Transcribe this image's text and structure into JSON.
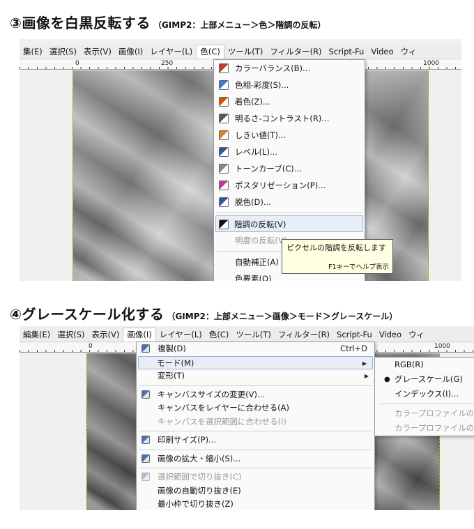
{
  "heading1": {
    "number": "③",
    "title": "画像を白黒反転する",
    "note": "（GIMP2：上部メニュー＞色＞階調の反転）"
  },
  "heading2": {
    "number": "④",
    "title": "グレースケール化する",
    "note": "（GIMP2：上部メニュー＞画像＞モード＞グレースケール）"
  },
  "shot1": {
    "menubar": [
      "集(E)",
      "選択(S)",
      "表示(V)",
      "画像(I)",
      "レイヤー(L)",
      "色(C)",
      "ツール(T)",
      "フィルター(R)",
      "Script-Fu",
      "Video",
      "ウィ"
    ],
    "ruler": [
      "0",
      "250",
      "1000"
    ],
    "colors_menu": {
      "items": [
        {
          "label": "カラーバランス(B)...",
          "icon": "color-balance-icon",
          "color": "#c0392b"
        },
        {
          "label": "色相-彩度(S)...",
          "icon": "hue-saturation-icon",
          "color": "#3b7bd4"
        },
        {
          "label": "着色(Z)...",
          "icon": "colorize-icon",
          "color": "#d35400"
        },
        {
          "label": "明るさ-コントラスト(R)...",
          "icon": "brightness-contrast-icon",
          "color": "#555555"
        },
        {
          "label": "しきい値(T)...",
          "icon": "threshold-icon",
          "color": "#e67e22"
        },
        {
          "label": "レベル(L)...",
          "icon": "levels-icon",
          "color": "#2c5aa0"
        },
        {
          "label": "トーンカーブ(C)...",
          "icon": "curves-icon",
          "color": "#888888"
        },
        {
          "label": "ポスタリゼーション(P)...",
          "icon": "posterize-icon",
          "color": "#c0399b"
        },
        {
          "label": "脱色(D)...",
          "icon": "desaturate-icon",
          "color": "#2c5aa0"
        }
      ],
      "highlighted": {
        "label": "階調の反転(V)",
        "icon": "invert-icon"
      },
      "after": [
        {
          "label": "明度の反転(V)",
          "disabled": true
        },
        {
          "label": "自動補正(A)",
          "disabled": false
        },
        {
          "label": "色要素(O)",
          "disabled": false
        }
      ]
    },
    "tooltip": {
      "text": "ピクセルの階調を反転します",
      "help": "F1キーでヘルプ表示"
    }
  },
  "shot2": {
    "menubar": [
      "編集(E)",
      "選択(S)",
      "表示(V)",
      "画像(I)",
      "レイヤー(L)",
      "色(C)",
      "ツール(T)",
      "フィルター(R)",
      "Script-Fu",
      "Video",
      "ウィ"
    ],
    "ruler": [
      "0",
      "1000"
    ],
    "image_menu": {
      "items": [
        {
          "label": "複製(D)",
          "shortcut": "Ctrl+D",
          "icon": "duplicate-icon"
        },
        {
          "label": "モード(M)",
          "submenu": true,
          "highlighted": true
        },
        {
          "label": "変形(T)",
          "submenu": true
        },
        {
          "sep": true
        },
        {
          "label": "キャンバスサイズの変更(V)...",
          "icon": "canvas-size-icon"
        },
        {
          "label": "キャンバスをレイヤーに合わせる(A)"
        },
        {
          "label": "キャンバスを選択範囲に合わせる(I)",
          "disabled": true
        },
        {
          "sep": true
        },
        {
          "label": "印刷サイズ(P)...",
          "icon": "print-size-icon"
        },
        {
          "sep": true
        },
        {
          "label": "画像の拡大・縮小(S)...",
          "icon": "scale-image-icon"
        },
        {
          "sep": true
        },
        {
          "label": "選択範囲で切り抜き(C)",
          "icon": "crop-icon",
          "disabled": true
        },
        {
          "label": "画像の自動切り抜き(E)"
        },
        {
          "label": "最小枠で切り抜き(Z)"
        }
      ]
    },
    "mode_menu": {
      "items": [
        {
          "label": "RGB(R)",
          "selected": false
        },
        {
          "label": "グレースケール(G)",
          "selected": true
        },
        {
          "label": "インデックス(I)...",
          "selected": false
        }
      ],
      "disabled": [
        "カラープロファイルの",
        "カラープロファイルの"
      ]
    }
  }
}
